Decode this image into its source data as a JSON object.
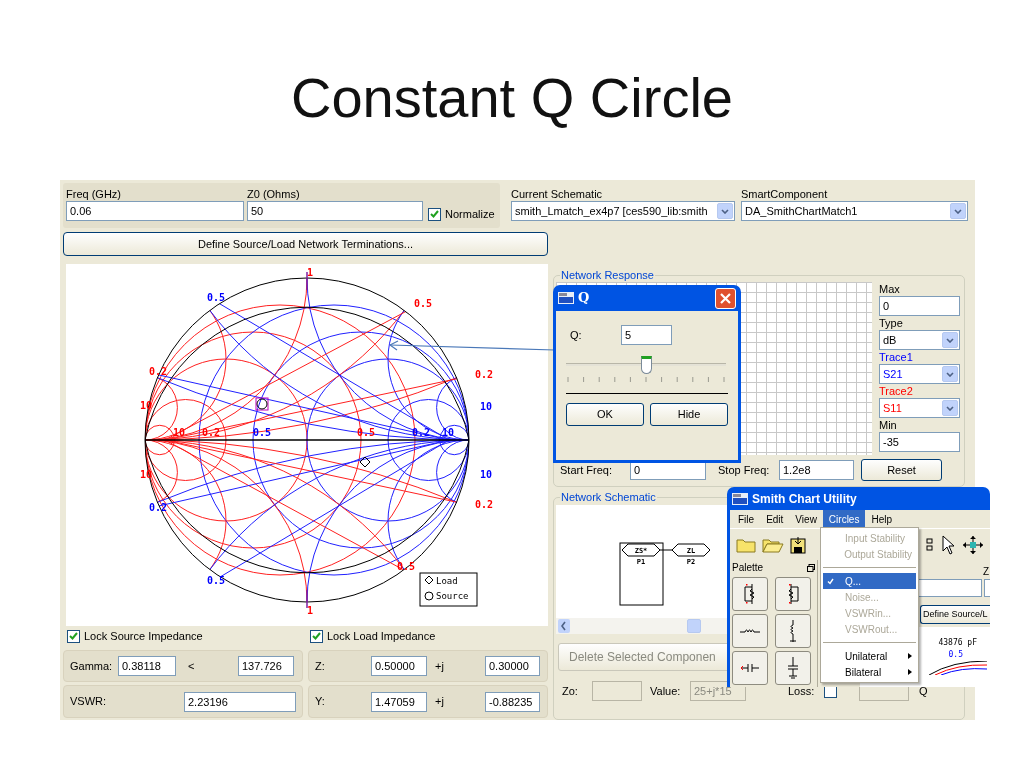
{
  "slide": {
    "title": "Constant Q Circle"
  },
  "top": {
    "freq": {
      "label": "Freq (GHz)",
      "value": "0.06"
    },
    "z0": {
      "label": "Z0 (Ohms)",
      "value": "50"
    },
    "normalize": {
      "label": "Normalize",
      "checked": true
    },
    "schematic": {
      "label": "Current Schematic",
      "value": "smith_Lmatch_ex4p7 [ces590_lib:smith"
    },
    "smart": {
      "label": "SmartComponent",
      "value": "DA_SmithChartMatch1"
    }
  },
  "define_button": "Define Source/Load Network Terminations...",
  "smith_chart": {
    "labels": [
      {
        "text": "1",
        "color": "#ff0000"
      },
      {
        "text": "0.5",
        "color": "#0000ff"
      },
      {
        "text": "0.5",
        "color": "#ff0000"
      },
      {
        "text": "0.2",
        "color": "#ff0000"
      },
      {
        "text": "10",
        "color": "#ff0000"
      },
      {
        "text": "0.2",
        "color": "#ff0000"
      },
      {
        "text": "10",
        "color": "#0000ff"
      },
      {
        "text": "10",
        "color": "#ff0000"
      },
      {
        "text": "0.2",
        "color": "#0000ff"
      },
      {
        "text": "10",
        "color": "#0000ff"
      },
      {
        "text": "0.2",
        "color": "#ff0000"
      },
      {
        "text": "0.5",
        "color": "#0000ff"
      },
      {
        "text": "0.5",
        "color": "#ff0000"
      },
      {
        "text": "1",
        "color": "#ff0000"
      },
      {
        "text": "10",
        "color": "#ff0000"
      },
      {
        "text": "0.2",
        "color": "#ff0000"
      },
      {
        "text": "0.5",
        "color": "#0000ff"
      },
      {
        "text": "0.5",
        "color": "#ff0000"
      },
      {
        "text": "0.2",
        "color": "#0000ff"
      },
      {
        "text": "10",
        "color": "#0000ff"
      }
    ],
    "legend": [
      "Load",
      "Source"
    ]
  },
  "lock_source": {
    "label": "Lock Source Impedance",
    "checked": true
  },
  "lock_load": {
    "label": "Lock Load Impedance",
    "checked": true
  },
  "gamma": {
    "label": "Gamma:",
    "magnitude": "0.38118",
    "separator": "<",
    "angle": "137.726"
  },
  "vswr": {
    "label": "VSWR:",
    "value": "2.23196"
  },
  "z": {
    "label": "Z:",
    "real": "0.50000",
    "j": "+j",
    "imag": "0.30000"
  },
  "y": {
    "label": "Y:",
    "real": "1.47059",
    "j": "+j",
    "imag": "-0.88235"
  },
  "network_response": {
    "title": "Network Response",
    "max": {
      "label": "Max",
      "value": "0"
    },
    "type": {
      "label": "Type",
      "value": "dB"
    },
    "traces": [
      {
        "label": "Trace1",
        "value": "S21",
        "color": "#0000ff"
      },
      {
        "label": "Trace2",
        "value": "S11",
        "color": "#ff0000"
      }
    ],
    "min": {
      "label": "Min",
      "value": "-35"
    },
    "start": {
      "label": "Start Freq:",
      "value": "0"
    },
    "stop": {
      "label": "Stop Freq:",
      "value": "1.2e8"
    },
    "reset": "Reset"
  },
  "network_schematic": {
    "title": "Network Schematic",
    "ports": [
      {
        "symbol": "ZS*",
        "name": "P1"
      },
      {
        "symbol": "ZL",
        "name": "P2"
      }
    ],
    "delete_button": "Delete Selected Componen",
    "zo": {
      "label": "Zo:"
    },
    "value": {
      "label": "Value:",
      "value": "25+j*15",
      "disabled": true
    },
    "loss": {
      "label": "Loss:",
      "checked": false
    },
    "q_label": "Q"
  },
  "q_dialog": {
    "title": "Q",
    "q": {
      "label": "Q:",
      "value": "5"
    },
    "slider": {
      "level": 0.5
    },
    "buttons": [
      "OK",
      "Hide"
    ]
  },
  "utility": {
    "title": "Smith Chart Utility",
    "menu": [
      {
        "label": "File",
        "selected": false
      },
      {
        "label": "Edit",
        "selected": false
      },
      {
        "label": "View",
        "selected": false
      },
      {
        "label": "Circles",
        "selected": true
      },
      {
        "label": "Help",
        "selected": false
      }
    ],
    "palette": "Palette",
    "z_label": "Z",
    "define_button": "Define Source/L",
    "capacitance": "43876 pF",
    "chart_label": "0.5",
    "circles_menu": [
      {
        "kind": "item",
        "label": "Input Stability",
        "disabled": true,
        "checked": false,
        "selected": false
      },
      {
        "kind": "item",
        "label": "Output Stability",
        "disabled": true,
        "checked": false,
        "selected": false
      },
      {
        "kind": "separator"
      },
      {
        "kind": "item",
        "label": "Q...",
        "disabled": false,
        "checked": true,
        "selected": true
      },
      {
        "kind": "item",
        "label": "Noise...",
        "disabled": true,
        "checked": false,
        "selected": false
      },
      {
        "kind": "item",
        "label": "VSWRin...",
        "disabled": true,
        "checked": false,
        "selected": false
      },
      {
        "kind": "item",
        "label": "VSWRout...",
        "disabled": true,
        "checked": false,
        "selected": false
      },
      {
        "kind": "separator"
      },
      {
        "kind": "submenu",
        "label": "Unilateral",
        "disabled": false,
        "checked": false,
        "selected": false
      },
      {
        "kind": "submenu",
        "label": "Bilateral",
        "disabled": false,
        "checked": false,
        "selected": false
      }
    ]
  }
}
